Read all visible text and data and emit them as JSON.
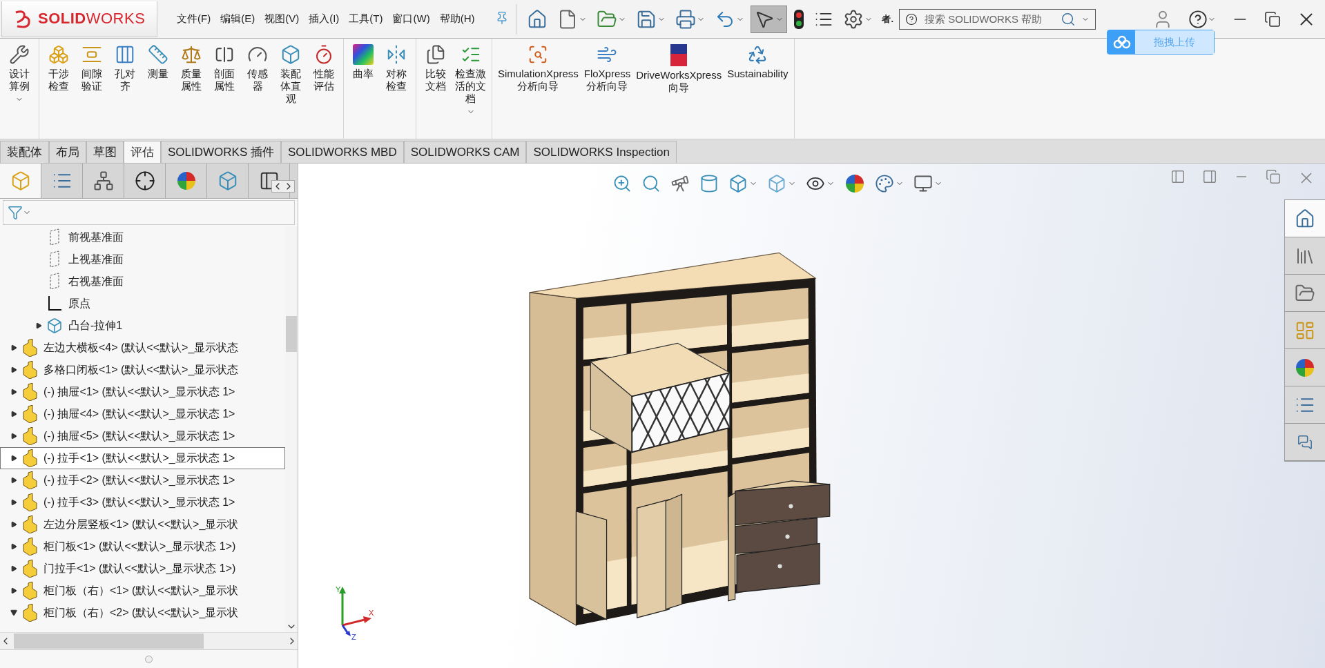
{
  "logo": "**SOLID**WORKS",
  "menu": [
    "文件(F)",
    "编辑(E)",
    "视图(V)",
    "插入(I)",
    "工具(T)",
    "窗口(W)",
    "帮助(H)"
  ],
  "toolbar": {
    "select_active": true,
    "note": "者."
  },
  "search": {
    "placeholder": "搜索 SOLIDWORKS 帮助"
  },
  "upload_badge": "拖拽上传",
  "ribbon": {
    "groups": [
      [
        {
          "lines": [
            "设计",
            "算例"
          ],
          "dropdown": true
        }
      ],
      [
        {
          "lines": [
            "干涉",
            "检查"
          ],
          "dropdown": false
        },
        {
          "lines": [
            "间隙",
            "验证"
          ],
          "dropdown": false
        },
        {
          "lines": [
            "孔对",
            "齐"
          ],
          "dropdown": false
        },
        {
          "lines": [
            "测量"
          ],
          "dropdown": false
        },
        {
          "lines": [
            "质量",
            "属性"
          ],
          "dropdown": false
        },
        {
          "lines": [
            "剖面",
            "属性"
          ],
          "dropdown": false
        },
        {
          "lines": [
            "传感",
            "器"
          ],
          "dropdown": false
        },
        {
          "lines": [
            "装配",
            "体直",
            "观"
          ],
          "dropdown": false
        },
        {
          "lines": [
            "性能",
            "评估"
          ],
          "dropdown": false
        }
      ],
      [
        {
          "lines": [
            "曲率"
          ],
          "dropdown": false
        },
        {
          "lines": [
            "对称",
            "检查"
          ],
          "dropdown": false
        }
      ],
      [
        {
          "lines": [
            "比较",
            "文档"
          ],
          "dropdown": false
        },
        {
          "lines": [
            "检查激",
            "活的文",
            "档"
          ],
          "dropdown": true
        }
      ],
      [
        {
          "lines": [
            "SimulationXpress",
            "分析向导"
          ],
          "dropdown": false
        },
        {
          "lines": [
            "FloXpress",
            "分析向导"
          ],
          "dropdown": false
        },
        {
          "lines": [
            "DriveWorksXpress",
            "向导"
          ],
          "dropdown": false
        },
        {
          "lines": [
            "Sustainability"
          ],
          "dropdown": false
        }
      ]
    ]
  },
  "tabs": [
    {
      "label": "装配体",
      "selected": false
    },
    {
      "label": "布局",
      "selected": false
    },
    {
      "label": "草图",
      "selected": false
    },
    {
      "label": "评估",
      "selected": true
    },
    {
      "label": "SOLIDWORKS 插件",
      "selected": false
    },
    {
      "label": "SOLIDWORKS MBD",
      "selected": false
    },
    {
      "label": "SOLIDWORKS CAM",
      "selected": false
    },
    {
      "label": "SOLIDWORKS Inspection",
      "selected": false
    }
  ],
  "panel_tabs": [
    {
      "selected": true
    },
    {
      "selected": false
    },
    {
      "selected": false
    },
    {
      "selected": false
    },
    {
      "selected": false
    },
    {
      "selected": false
    },
    {
      "selected": false
    }
  ],
  "tree": [
    {
      "kind": "plane",
      "label": "前视基准面",
      "selected": false
    },
    {
      "kind": "plane",
      "label": "上视基准面",
      "selected": false
    },
    {
      "kind": "plane",
      "label": "右视基准面",
      "selected": false
    },
    {
      "kind": "origin",
      "label": "原点",
      "selected": false
    },
    {
      "kind": "feature",
      "label": "凸台-拉伸1",
      "expanded": false,
      "selected": false
    },
    {
      "kind": "part",
      "label": "左边大横板<4> (默认<<默认>_显示状态",
      "expanded": false,
      "selected": false
    },
    {
      "kind": "part",
      "label": "多格口闭板<1> (默认<<默认>_显示状态",
      "expanded": false,
      "selected": false
    },
    {
      "kind": "part",
      "label": "(-) 抽屉<1> (默认<<默认>_显示状态 1>",
      "expanded": false,
      "selected": false
    },
    {
      "kind": "part",
      "label": "(-) 抽屉<4> (默认<<默认>_显示状态 1>",
      "expanded": false,
      "selected": false
    },
    {
      "kind": "part",
      "label": "(-) 抽屉<5> (默认<<默认>_显示状态 1>",
      "expanded": false,
      "selected": false
    },
    {
      "kind": "part",
      "label": "(-) 拉手<1> (默认<<默认>_显示状态 1>",
      "expanded": false,
      "selected": true
    },
    {
      "kind": "part",
      "label": "(-) 拉手<2> (默认<<默认>_显示状态 1>",
      "expanded": false,
      "selected": false
    },
    {
      "kind": "part",
      "label": "(-) 拉手<3> (默认<<默认>_显示状态 1>",
      "expanded": false,
      "selected": false
    },
    {
      "kind": "part",
      "label": "左边分层竖板<1> (默认<<默认>_显示状",
      "expanded": false,
      "selected": false
    },
    {
      "kind": "part",
      "label": "柜门板<1> (默认<<默认>_显示状态 1>)",
      "expanded": false,
      "selected": false
    },
    {
      "kind": "part",
      "label": "门拉手<1> (默认<<默认>_显示状态 1>)",
      "expanded": false,
      "selected": false
    },
    {
      "kind": "part",
      "label": "柜门板（右）<1> (默认<<默认>_显示状",
      "expanded": false,
      "selected": false
    },
    {
      "kind": "part",
      "label": "柜门板（右）<2> (默认<<默认>_显示状",
      "expanded": true,
      "selected": false
    }
  ],
  "triad": {
    "x": "X",
    "y": "Y",
    "z": "Z"
  },
  "task_pane": [
    {
      "selected": true
    },
    {
      "selected": false
    },
    {
      "selected": false
    },
    {
      "selected": false
    },
    {
      "selected": false
    },
    {
      "selected": false
    },
    {
      "selected": false
    }
  ]
}
